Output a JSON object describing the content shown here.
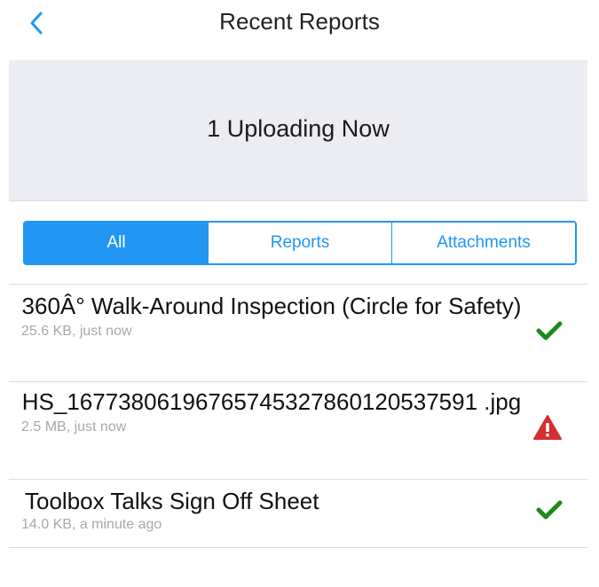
{
  "header": {
    "back_icon": "chevron-left-icon",
    "title": "Recent Reports"
  },
  "upload_banner": {
    "text": "1 Uploading Now"
  },
  "tabs": [
    {
      "label": "All",
      "active": true
    },
    {
      "label": "Reports",
      "active": false
    },
    {
      "label": "Attachments",
      "active": false
    }
  ],
  "items": [
    {
      "title": "360Â° Walk-Around Inspection (Circle for Safety)",
      "meta": "25.6 KB, just now",
      "status": "success",
      "status_icon": "checkmark-icon"
    },
    {
      "title": "HS_16773806196765745327860120537591 .jpg",
      "meta": "2.5 MB, just now",
      "status": "error",
      "status_icon": "warning-icon"
    },
    {
      "title": "Toolbox Talks Sign Off Sheet",
      "meta": "14.0 KB, a minute ago",
      "status": "success",
      "status_icon": "checkmark-icon"
    }
  ],
  "colors": {
    "accent": "#2196f3",
    "success": "#1e8a1e",
    "error": "#d32f2f",
    "banner_bg": "#ecedf2"
  }
}
